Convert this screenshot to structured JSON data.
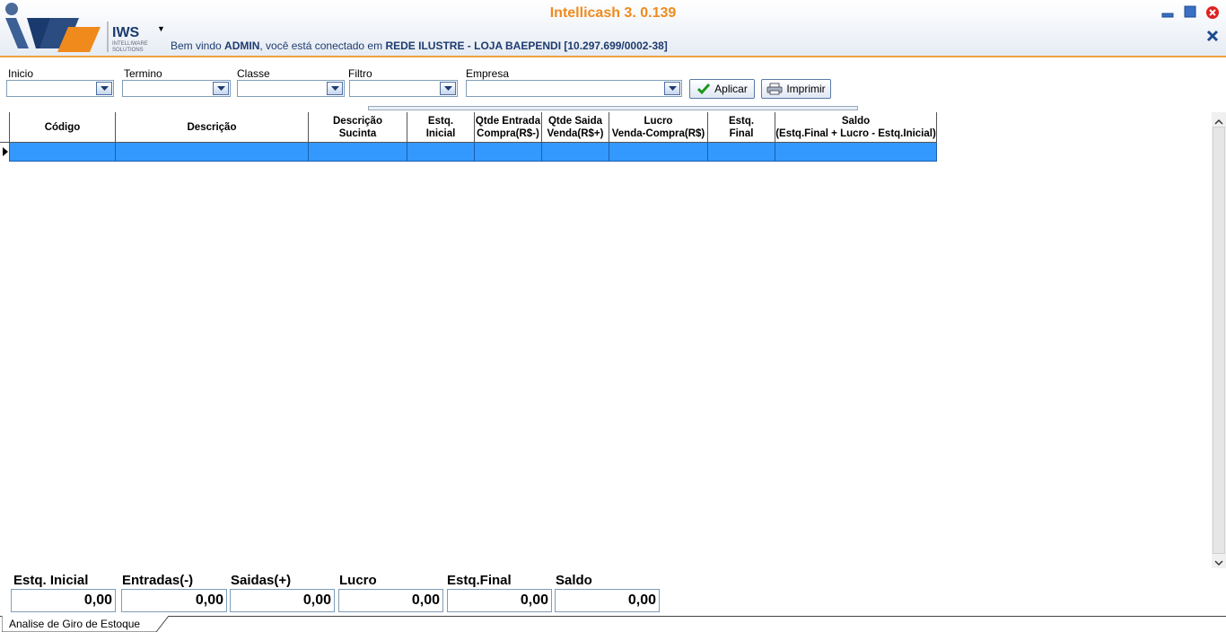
{
  "header": {
    "title": "Intellicash 3. 0.139",
    "logo_text": "IWS",
    "logo_sub1": "INTELLIWARE",
    "logo_sub2": "SOLUTIONS",
    "welcome_prefix": "Bem vindo ",
    "user": "ADMIN",
    "welcome_mid": ", você está conectado em ",
    "location": "REDE ILUSTRE - LOJA BAEPENDI [10.297.699/0002-38]"
  },
  "filters": {
    "inicio_label": "Inicio",
    "termino_label": "Termino",
    "classe_label": "Classe",
    "filtro_label": "Filtro",
    "empresa_label": "Empresa",
    "aplicar": "Aplicar",
    "imprimir": "Imprimir"
  },
  "grid": {
    "columns": [
      {
        "l1": "Código",
        "l2": ""
      },
      {
        "l1": "Descrição",
        "l2": ""
      },
      {
        "l1": "Descrição",
        "l2": "Sucinta"
      },
      {
        "l1": "Estq.",
        "l2": "Inicial"
      },
      {
        "l1": "Qtde Entrada",
        "l2": "Compra(R$-)"
      },
      {
        "l1": "Qtde Saida",
        "l2": "Venda(R$+)"
      },
      {
        "l1": "Lucro",
        "l2": "Venda-Compra(R$)"
      },
      {
        "l1": "Estq.",
        "l2": "Final"
      },
      {
        "l1": "Saldo",
        "l2": "(Estq.Final + Lucro - Estq.Inicial)"
      }
    ]
  },
  "totals": {
    "estq_inicial_label": "Estq. Inicial",
    "estq_inicial": "0,00",
    "entradas_label": "Entradas(-)",
    "entradas": "0,00",
    "saidas_label": "Saidas(+)",
    "saidas": "0,00",
    "lucro_label": "Lucro",
    "lucro": "0,00",
    "estq_final_label": "Estq.Final",
    "estq_final": "0,00",
    "saldo_label": "Saldo",
    "saldo": "0,00"
  },
  "tabs": {
    "active": "Analise de Giro de Estoque"
  },
  "colors": {
    "accent": "#f08a1c",
    "selection": "#3399ff",
    "text_blue": "#1e3c6e"
  }
}
